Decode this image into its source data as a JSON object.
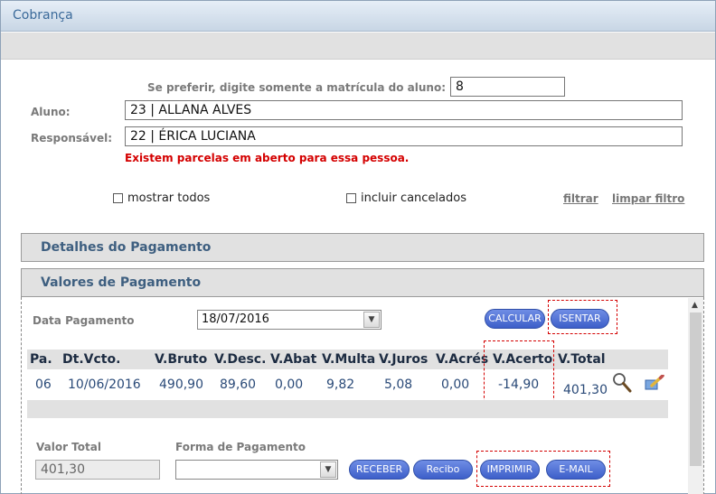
{
  "window": {
    "title": "Cobrança"
  },
  "search": {
    "matricula_label": "Se preferir, digite somente a matrícula do aluno:",
    "matricula_value": "8",
    "aluno_label": "Aluno:",
    "aluno_value": "23 | ALLANA ALVES",
    "responsavel_label": "Responsável:",
    "responsavel_value": "22 | ÉRICA LUCIANA",
    "warning": "Existem parcelas em aberto para essa pessoa."
  },
  "filters": {
    "mostrar_todos": "mostrar todos",
    "incluir_cancelados": "incluir cancelados",
    "filtrar": "filtrar",
    "limpar_filtro": "limpar filtro"
  },
  "panels": {
    "detalhes": "Detalhes do Pagamento",
    "valores": "Valores de Pagamento"
  },
  "payment": {
    "data_label": "Data Pagamento",
    "data_value": "18/07/2016",
    "calcular": "CALCULAR",
    "isentar": "ISENTAR"
  },
  "table": {
    "headers": [
      "Pa.",
      "Dt.Vcto.",
      "V.Bruto",
      "V.Desc.",
      "V.Abat",
      "V.Multa",
      "V.Juros",
      "V.Acrés",
      "V.Acerto",
      "V.Total"
    ],
    "row": [
      "06",
      "10/06/2016",
      "490,90",
      "89,60",
      "0,00",
      "9,82",
      "5,08",
      "0,00",
      "-14,90",
      "401,30"
    ]
  },
  "footer": {
    "valor_total_label": "Valor Total",
    "valor_total_value": "401,30",
    "forma_label": "Forma de Pagamento",
    "forma_value": "",
    "receber": "RECEBER",
    "recibo": "Recibo",
    "imprimir": "IMPRIMIR",
    "email": "E-MAIL"
  },
  "colors": {
    "accent": "#3d5fc9",
    "warning": "#d40000",
    "header_text": "#3e5f80"
  },
  "icons": [
    "search-icon",
    "edit-icon",
    "chevron-down-icon",
    "scroll-up-arrow-icon"
  ]
}
